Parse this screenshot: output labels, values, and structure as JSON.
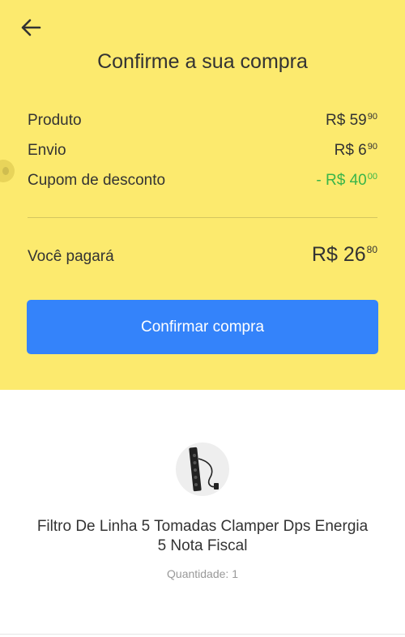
{
  "header": {
    "back_icon": "arrow-left-icon",
    "title": "Confirme a sua compra"
  },
  "summary": {
    "rows": [
      {
        "label": "Produto",
        "currency": "R$",
        "integer": "59",
        "cents": "90"
      },
      {
        "label": "Envio",
        "currency": "R$",
        "integer": "6",
        "cents": "90"
      },
      {
        "label": "Cupom de desconto",
        "currency": "- R$",
        "integer": "40",
        "cents": "00"
      }
    ],
    "total": {
      "label": "Você pagará",
      "currency": "R$",
      "integer": "26",
      "cents": "80"
    }
  },
  "confirm_button": {
    "label": "Confirmar compra"
  },
  "product": {
    "name": "Filtro De Linha 5 Tomadas Clamper Dps Energia 5 Nota Fiscal",
    "quantity_label": "Quantidade: 1"
  },
  "colors": {
    "header_bg": "#fcea6e",
    "button_bg": "#3483fa",
    "discount": "#39b54a",
    "text": "#333333",
    "muted": "#999999"
  }
}
